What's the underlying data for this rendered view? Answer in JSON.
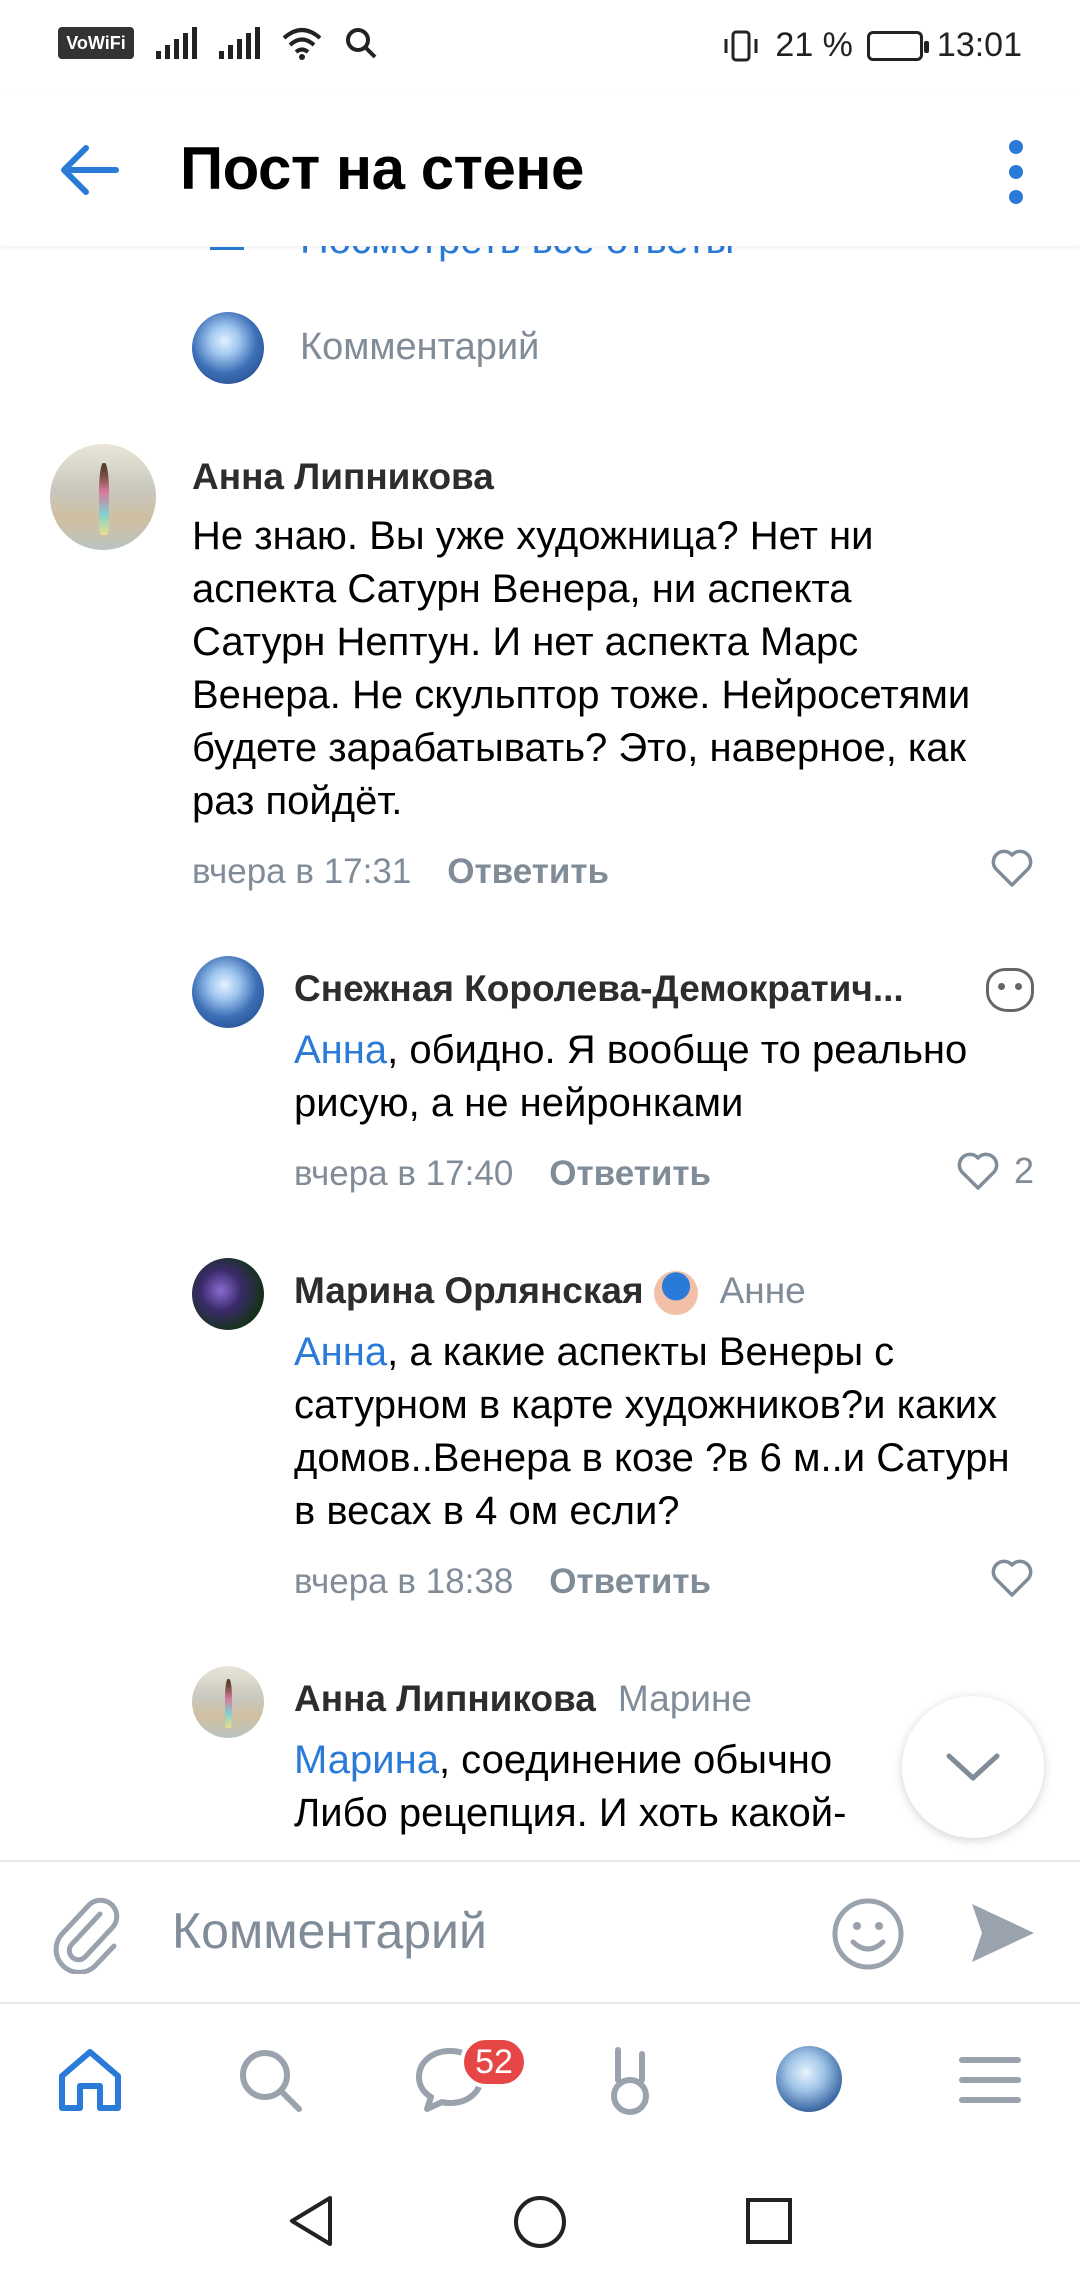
{
  "status_bar": {
    "vowifi": "VoWiFi",
    "battery": "21 %",
    "time": "13:01"
  },
  "header": {
    "title": "Пост на стене"
  },
  "feed": {
    "view_all_replies": "Посмотреть все ответы",
    "reply_placeholder": "Комментарий",
    "comments": [
      {
        "author": "Анна Липникова",
        "text": "Не знаю. Вы уже художница? Нет ни аспекта Сатурн Венера, ни аспекта Сатурн Нептун. И нет аспекта Марс Венера. Не скульптор тоже. Нейросетями будете зарабатывать? Это, наверное, как раз пойдёт.",
        "time": "вчера в 17:31",
        "reply": "Ответить"
      },
      {
        "author": "Снежная Королева-Демократич...",
        "mention": "Анна",
        "text": ", обидно. Я вообще то реально рисую, а не нейронками",
        "time": "вчера в 17:40",
        "reply": "Ответить",
        "likes": "2"
      },
      {
        "author": "Марина Орлянская",
        "reply_to": "Анне",
        "mention": "Анна",
        "text": ", а какие аспекты Венеры с сатурном в карте художников?и каких домов..Венера  в козе ?в 6 м..и Сатурн в весах в 4 ом если?",
        "time": "вчера в 18:38",
        "reply": "Ответить"
      },
      {
        "author": "Анна Липникова",
        "reply_to": "Марине",
        "mention": "Марина",
        "text_line1": ", соединение обычно",
        "text_line2": "Либо рецепция. И хоть какой-"
      }
    ]
  },
  "composer": {
    "placeholder": "Комментарий"
  },
  "bottom_nav": {
    "messages_badge": "52"
  },
  "colors": {
    "accent": "#2a7ad8",
    "secondary_text": "#818c99",
    "badge": "#e64646"
  }
}
